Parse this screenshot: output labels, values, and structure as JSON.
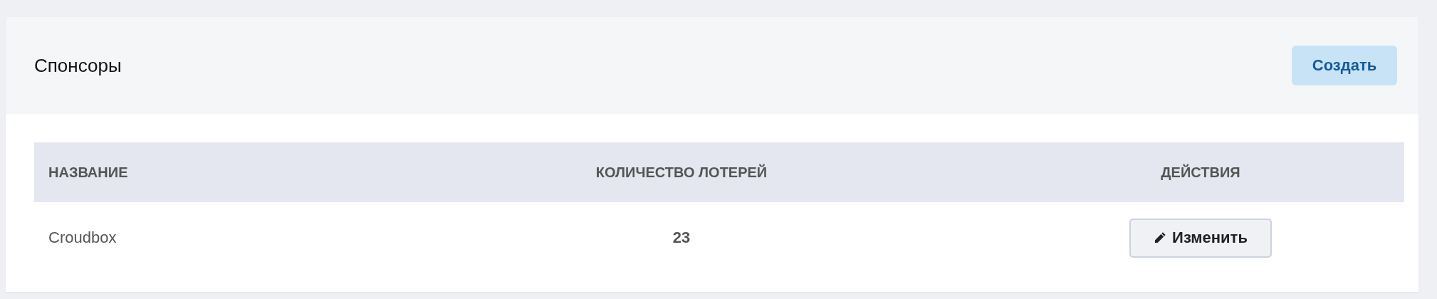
{
  "card": {
    "title": "Спонсоры",
    "create_button": "Создать"
  },
  "table": {
    "columns": [
      "НАЗВАНИЕ",
      "КОЛИЧЕСТВО ЛОТЕРЕЙ",
      "ДЕЙСТВИЯ"
    ],
    "rows": [
      {
        "name": "Croudbox",
        "count": "23",
        "action": "Изменить"
      }
    ]
  }
}
